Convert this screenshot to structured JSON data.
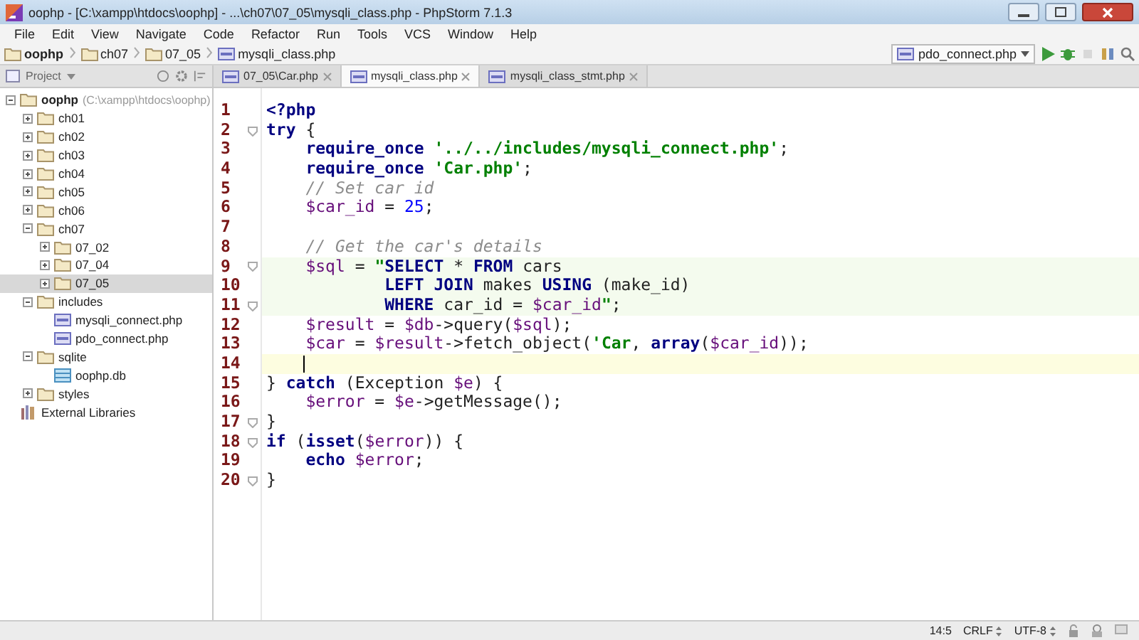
{
  "window": {
    "title": "oophp - [C:\\xampp\\htdocs\\oophp] - ...\\ch07\\07_05\\mysqli_class.php - PhpStorm 7.1.3"
  },
  "menu": [
    "File",
    "Edit",
    "View",
    "Navigate",
    "Code",
    "Refactor",
    "Run",
    "Tools",
    "VCS",
    "Window",
    "Help"
  ],
  "breadcrumbs": [
    {
      "label": "oophp",
      "kind": "folder",
      "bold": true
    },
    {
      "label": "ch07",
      "kind": "folder",
      "bold": false
    },
    {
      "label": "07_05",
      "kind": "folder",
      "bold": false
    },
    {
      "label": "mysqli_class.php",
      "kind": "php",
      "bold": false
    }
  ],
  "run_config": {
    "label": "pdo_connect.php"
  },
  "project_panel": {
    "label": "Project"
  },
  "tabs": [
    {
      "label": "07_05\\Car.php",
      "selected": false
    },
    {
      "label": "mysqli_class.php",
      "selected": true
    },
    {
      "label": "mysqli_class_stmt.php",
      "selected": false
    }
  ],
  "tree": [
    {
      "label": "oophp",
      "hint": "(C:\\xampp\\htdocs\\oophp)",
      "kind": "folder",
      "expanded": true,
      "selected": false,
      "children": [
        {
          "label": "ch01",
          "kind": "folder",
          "expanded": false,
          "selected": false
        },
        {
          "label": "ch02",
          "kind": "folder",
          "expanded": false,
          "selected": false
        },
        {
          "label": "ch03",
          "kind": "folder",
          "expanded": false,
          "selected": false
        },
        {
          "label": "ch04",
          "kind": "folder",
          "expanded": false,
          "selected": false
        },
        {
          "label": "ch05",
          "kind": "folder",
          "expanded": false,
          "selected": false
        },
        {
          "label": "ch06",
          "kind": "folder",
          "expanded": false,
          "selected": false
        },
        {
          "label": "ch07",
          "kind": "folder",
          "expanded": true,
          "selected": false,
          "children": [
            {
              "label": "07_02",
              "kind": "folder",
              "expanded": false,
              "selected": false
            },
            {
              "label": "07_04",
              "kind": "folder",
              "expanded": false,
              "selected": false
            },
            {
              "label": "07_05",
              "kind": "folder",
              "expanded": false,
              "selected": true
            }
          ]
        },
        {
          "label": "includes",
          "kind": "folder",
          "expanded": true,
          "selected": false,
          "children": [
            {
              "label": "mysqli_connect.php",
              "kind": "php",
              "selected": false
            },
            {
              "label": "pdo_connect.php",
              "kind": "php",
              "selected": false
            }
          ]
        },
        {
          "label": "sqlite",
          "kind": "folder",
          "expanded": true,
          "selected": false,
          "children": [
            {
              "label": "oophp.db",
              "kind": "db",
              "selected": false
            }
          ]
        },
        {
          "label": "styles",
          "kind": "folder",
          "expanded": false,
          "selected": false
        }
      ]
    },
    {
      "label": "External Libraries",
      "kind": "library",
      "selected": false
    }
  ],
  "code": [
    {
      "n": "1",
      "fold": false,
      "injected": false,
      "current": false,
      "text": "**<?php**"
    },
    {
      "n": "2",
      "fold": true,
      "injected": false,
      "current": false,
      "text": "**try** {"
    },
    {
      "n": "3",
      "fold": false,
      "injected": false,
      "current": false,
      "text": "    **require_once** '../../includes/mysqli_connect.php';"
    },
    {
      "n": "4",
      "fold": false,
      "injected": false,
      "current": false,
      "text": "    **require_once** 'Car.php';"
    },
    {
      "n": "5",
      "fold": false,
      "injected": false,
      "current": false,
      "text": "    // Set car id"
    },
    {
      "n": "6",
      "fold": false,
      "injected": false,
      "current": false,
      "text": "    $car_id = 25;"
    },
    {
      "n": "7",
      "fold": false,
      "injected": false,
      "current": false
    },
    {
      "n": "8",
      "fold": false,
      "injected": false,
      "current": false,
      "text": "    // Get the car's details"
    },
    {
      "n": "9",
      "fold": true,
      "injected": true,
      "current": false,
      "text": "    $sql = \"**SELECT** * **FROM** cars"
    },
    {
      "n": "10",
      "fold": false,
      "injected": true,
      "current": false,
      "text": "            **LEFT JOIN** makes **USING** (make_id)"
    },
    {
      "n": "11",
      "fold": true,
      "injected": true,
      "current": false,
      "text": "            **WHERE** car_id = $car_id\";"
    },
    {
      "n": "12",
      "fold": false,
      "injected": false,
      "current": false,
      "text": "    $result = $db->query($sql);"
    },
    {
      "n": "13",
      "fold": false,
      "injected": false,
      "current": false,
      "text": "    $car = $result->fetch_object('Car, **array**($car_id));"
    },
    {
      "n": "14",
      "fold": false,
      "injected": false,
      "current": true
    },
    {
      "n": "15",
      "fold": false,
      "injected": false,
      "current": false,
      "text": "} **catch** (Exception $e) {"
    },
    {
      "n": "16",
      "fold": false,
      "injected": false,
      "current": false,
      "text": "    $error = $e->getMessage();"
    },
    {
      "n": "17",
      "fold": true,
      "injected": false,
      "current": false,
      "text": "}"
    },
    {
      "n": "18",
      "fold": true,
      "injected": false,
      "current": false,
      "text": "**if** (**isset**($error)) {"
    },
    {
      "n": "19",
      "fold": false,
      "injected": false,
      "current": false,
      "text": "    **echo** $error;"
    },
    {
      "n": "20",
      "fold": true,
      "injected": false,
      "current": false,
      "text": "}"
    }
  ],
  "status_bar": {
    "position": "14:5",
    "line_separator": "CRLF",
    "encoding": "UTF-8"
  }
}
